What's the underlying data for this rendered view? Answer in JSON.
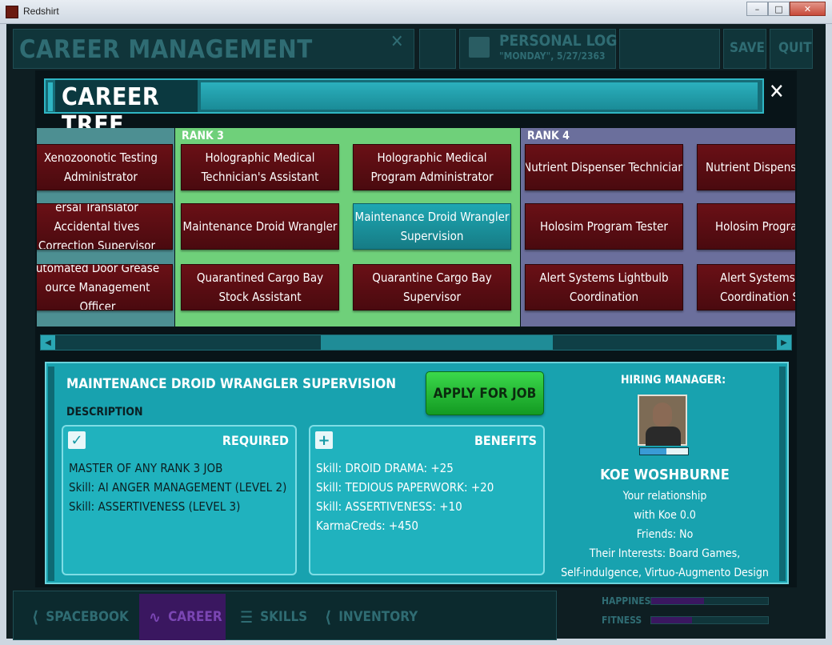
{
  "window": {
    "title": "Redshirt",
    "buttons": [
      "–",
      "□",
      "✕"
    ]
  },
  "background": {
    "career_title": "CAREER MANAGEMENT",
    "personal_log": {
      "title": "PERSONAL LOG",
      "date": "\"MONDAY\", 5/27/2363"
    },
    "save_label": "SAVE",
    "quit_label": "QUIT",
    "tabs": [
      {
        "label": "SPACEBOOK",
        "icon": "share-icon"
      },
      {
        "label": "CAREER",
        "icon": "career-path-icon",
        "active": true
      },
      {
        "label": "SKILLS",
        "icon": "list-icon"
      },
      {
        "label": "INVENTORY",
        "icon": "share-icon"
      }
    ],
    "stats": [
      {
        "label": "HAPPINESS",
        "value": 0.45
      },
      {
        "label": "FITNESS",
        "value": 0.35
      }
    ]
  },
  "career_tree": {
    "title": "CAREER TREE",
    "ranks": [
      {
        "label": "",
        "jobs": [
          "Xenozoonotic Testing Administrator",
          "ersal Translator Accidental tives Correction Supervisor",
          "utomated Door Grease ource Management Officer"
        ]
      },
      {
        "label": "RANK 3",
        "jobs_left": [
          "Holographic Medical Technician's Assistant",
          "Maintenance Droid Wrangler",
          "Quarantined Cargo Bay Stock Assistant"
        ],
        "jobs_right": [
          "Holographic Medical Program Administrator",
          "Maintenance Droid Wrangler Supervision",
          "Quarantine Cargo Bay Supervisor"
        ]
      },
      {
        "label": "RANK 4",
        "jobs_left": [
          "Nutrient Dispenser Technician",
          "Holosim Program Tester",
          "Alert Systems Lightbulb Coordination"
        ],
        "jobs_right": [
          "Nutrient Dispenser",
          "Holosim Progran",
          "Alert Systems L Coordination Su"
        ]
      }
    ],
    "scroll_position": 0.37
  },
  "job_detail": {
    "title": "MAINTENANCE DROID WRANGLER SUPERVISION",
    "description_label": "DESCRIPTION",
    "apply_label": "APPLY FOR JOB",
    "required": {
      "header": "REQUIRED",
      "lines": [
        "MASTER OF ANY RANK 3 JOB",
        "Skill: AI ANGER MANAGEMENT (LEVEL 2)",
        "Skill: ASSERTIVENESS (LEVEL 3)"
      ]
    },
    "benefits": {
      "header": "BENEFITS",
      "lines": [
        "Skill: DROID DRAMA: +25",
        "Skill: TEDIOUS PAPERWORK: +20",
        "Skill: ASSERTIVENESS: +10",
        "KarmaCreds: +450"
      ]
    }
  },
  "hiring_manager": {
    "label": "HIRING MANAGER:",
    "name": "KOE WOSHBURNE",
    "relationship_line1": "Your relationship",
    "relationship_line2": "with Koe 0.0",
    "friends": "Friends: No",
    "interests_line1": "Their Interests: Board Games,",
    "interests_line2": "Self-indulgence, Virtuo-Augmento Design",
    "relationship_bar": 0.55
  }
}
